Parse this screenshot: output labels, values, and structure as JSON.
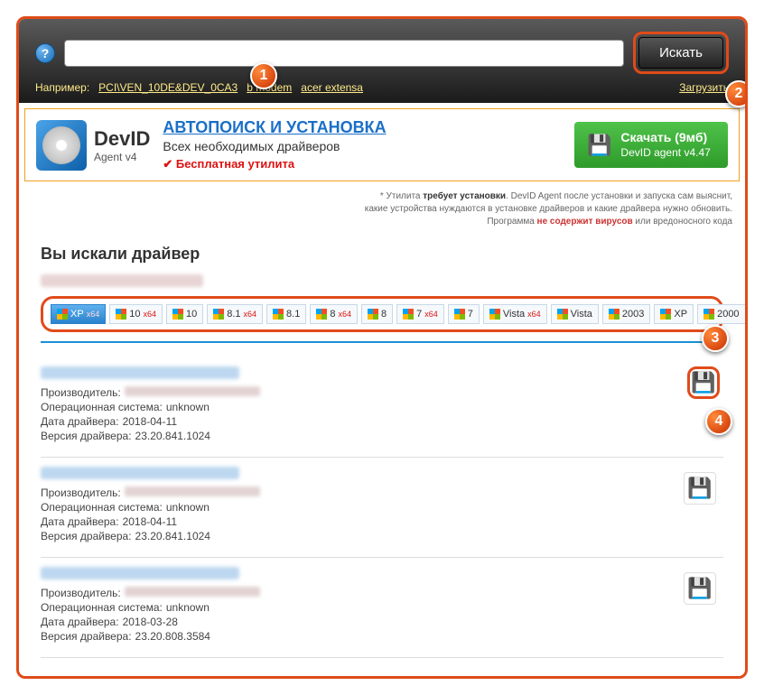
{
  "topbar": {
    "search_value": "",
    "search_button": "Искать",
    "example_label": "Например:",
    "example_links": [
      "PCI\\VEN_10DE&DEV_0CA3",
      "b modem",
      "acer extensa"
    ],
    "upload_link": "Загрузить"
  },
  "promo": {
    "brand": "DevID",
    "agent": "Agent v4",
    "headline": "АВТОПОИСК И УСТАНОВКА",
    "sub": "Всех необходимых драйверов",
    "free": "Бесплатная утилита",
    "download_top": "Скачать (9мб)",
    "download_bottom": "DevID agent v4.47"
  },
  "disclaimer": {
    "line1_pre": "* Утилита ",
    "line1_b": "требует установки",
    "line1_post": ". DevID Agent после установки и запуска сам выяснит,",
    "line2": "какие устройства нуждаются в установке драйверов и какие драйвера нужно обновить.",
    "line3_pre": "Программа ",
    "line3_red": "не содержит вирусов",
    "line3_post": " или вредоносного кода"
  },
  "results": {
    "heading": "Вы искали драйвер",
    "labels": {
      "manufacturer": "Производитель:",
      "os": "Операционная система:",
      "date": "Дата драйвера:",
      "version": "Версия драйвера:"
    },
    "items": [
      {
        "os": "unknown",
        "date": "2018-04-11",
        "version": "23.20.841.1024"
      },
      {
        "os": "unknown",
        "date": "2018-04-11",
        "version": "23.20.841.1024"
      },
      {
        "os": "unknown",
        "date": "2018-03-28",
        "version": "23.20.808.3584"
      }
    ]
  },
  "os_tabs": [
    {
      "label": "XP",
      "x64": true,
      "active": true
    },
    {
      "label": "10",
      "x64": true
    },
    {
      "label": "10"
    },
    {
      "label": "8.1",
      "x64": true
    },
    {
      "label": "8.1"
    },
    {
      "label": "8",
      "x64": true
    },
    {
      "label": "8"
    },
    {
      "label": "7",
      "x64": true
    },
    {
      "label": "7"
    },
    {
      "label": "Vista",
      "x64": true
    },
    {
      "label": "Vista"
    },
    {
      "label": "2003"
    },
    {
      "label": "XP"
    },
    {
      "label": "2000"
    }
  ],
  "markers": [
    "1",
    "2",
    "3",
    "4"
  ]
}
